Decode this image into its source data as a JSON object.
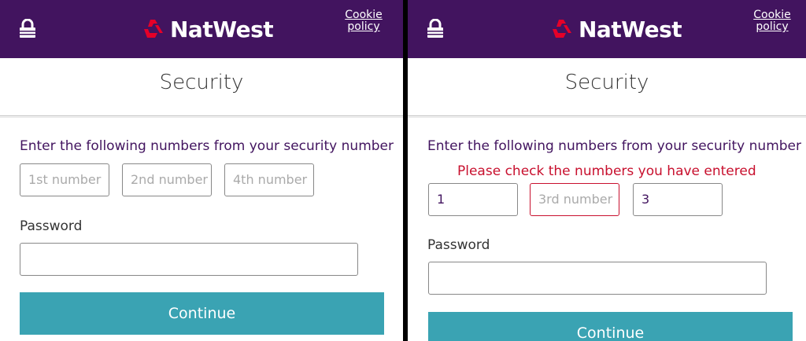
{
  "brand": {
    "name": "NatWest",
    "header_color": "#42145f",
    "logo_color": "#e60028",
    "button_color": "#3aa3b3",
    "error_color": "#c8102e"
  },
  "panels": [
    {
      "cookie_line1": "Cookie",
      "cookie_line2": "policy",
      "title": "Security",
      "instruction": "Enter the following numbers from your security number",
      "fields": [
        {
          "value": "",
          "placeholder": "1st number"
        },
        {
          "value": "",
          "placeholder": "2nd number"
        },
        {
          "value": "",
          "placeholder": "4th number"
        }
      ],
      "password_label": "Password",
      "password_value": "",
      "continue_label": "Continue"
    },
    {
      "cookie_line1": "Cookie",
      "cookie_line2": "policy",
      "title": "Security",
      "instruction": "Enter the following numbers from your security number",
      "error": "Please check the numbers you have entered",
      "fields": [
        {
          "value": "1",
          "placeholder": ""
        },
        {
          "value": "",
          "placeholder": "3rd number"
        },
        {
          "value": "3",
          "placeholder": ""
        }
      ],
      "password_label": "Password",
      "password_value": "",
      "continue_label": "Continue"
    }
  ]
}
